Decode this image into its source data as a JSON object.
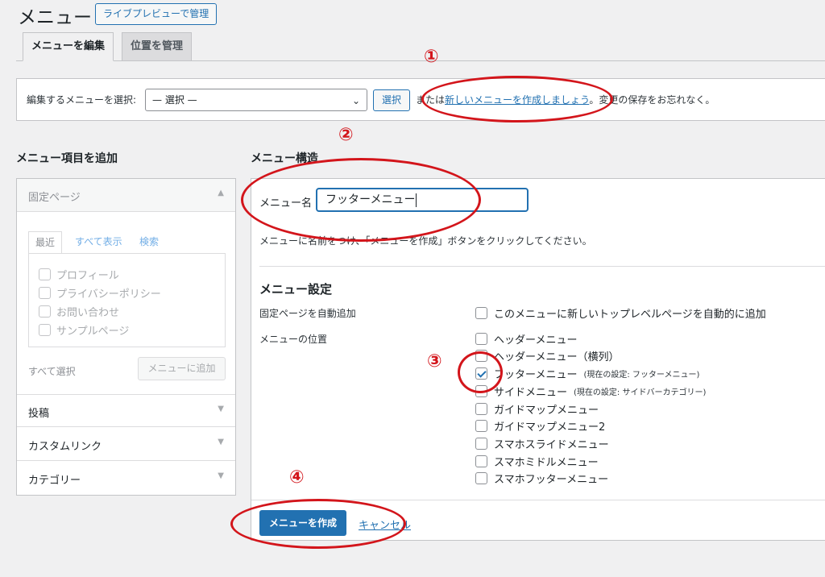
{
  "header": {
    "title": "メニュー",
    "live_preview_button": "ライブプレビューで管理",
    "tabs": [
      {
        "label": "メニューを編集",
        "active": true
      },
      {
        "label": "位置を管理",
        "active": false
      }
    ]
  },
  "select_menu": {
    "label": "編集するメニューを選択:",
    "selected": "— 選択 —",
    "select_button": "選択",
    "hint_prefix": "または",
    "hint_link": "新しいメニューを作成しましょう",
    "hint_suffix": "。変更の保存をお忘れなく。"
  },
  "add_items": {
    "heading": "メニュー項目を追加",
    "sections": [
      {
        "label": "固定ページ",
        "expanded": true
      },
      {
        "label": "投稿",
        "expanded": false
      },
      {
        "label": "カスタムリンク",
        "expanded": false
      },
      {
        "label": "カテゴリー",
        "expanded": false
      }
    ],
    "inner_tabs": [
      "最近",
      "すべて表示",
      "検索"
    ],
    "pages": [
      "プロフィール",
      "プライバシーポリシー",
      "お問い合わせ",
      "サンプルページ"
    ],
    "select_all": "すべて選択",
    "add_button": "メニューに追加"
  },
  "structure": {
    "heading": "メニュー構造",
    "name_label": "メニュー名",
    "name_value": "フッターメニュー",
    "instruction": "メニューに名前をつけ、「メニューを作成」ボタンをクリックしてください。",
    "settings_heading": "メニュー設定",
    "auto_add_label": "固定ページを自動追加",
    "auto_add_option": "このメニューに新しいトップレベルページを自動的に追加",
    "location_label": "メニューの位置",
    "locations": [
      {
        "label": "ヘッダーメニュー",
        "current": "",
        "checked": false
      },
      {
        "label": "ヘッダーメニュー（横列）",
        "current": "",
        "checked": false
      },
      {
        "label": "フッターメニュー",
        "current": "(現在の設定: フッターメニュー)",
        "checked": true
      },
      {
        "label": "サイドメニュー",
        "current": "(現在の設定: サイドバーカテゴリー)",
        "checked": false
      },
      {
        "label": "ガイドマップメニュー",
        "current": "",
        "checked": false
      },
      {
        "label": "ガイドマップメニュー2",
        "current": "",
        "checked": false
      },
      {
        "label": "スマホスライドメニュー",
        "current": "",
        "checked": false
      },
      {
        "label": "スマホミドルメニュー",
        "current": "",
        "checked": false
      },
      {
        "label": "スマホフッターメニュー",
        "current": "",
        "checked": false
      }
    ],
    "create_button": "メニューを作成",
    "cancel_link": "キャンセル"
  },
  "annotations": {
    "markers": [
      "①",
      "②",
      "③",
      "④"
    ],
    "color": "#d3151b"
  },
  "colors": {
    "accent": "#2271b1",
    "background": "#f0f0f1"
  }
}
